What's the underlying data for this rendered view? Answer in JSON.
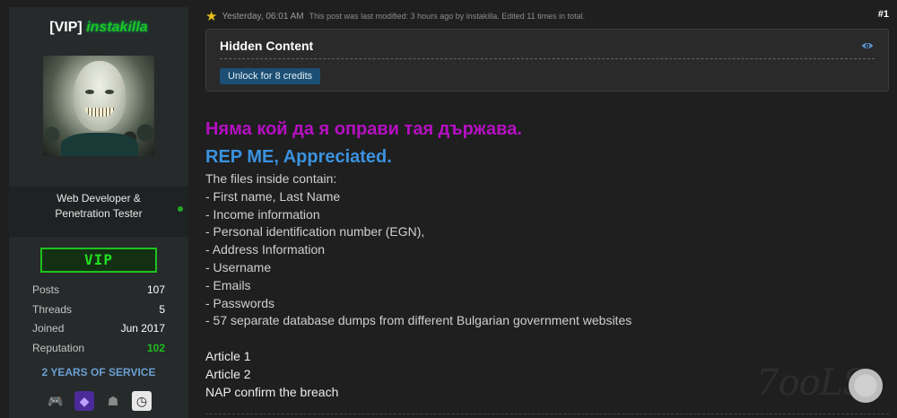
{
  "user": {
    "vip_tag": "[VIP]",
    "name": "instakilla",
    "title_line1": "Web Developer &",
    "title_line2": "Penetration Tester",
    "badge": "VIP",
    "stats": [
      {
        "label": "Posts",
        "value": "107"
      },
      {
        "label": "Threads",
        "value": "5"
      },
      {
        "label": "Joined",
        "value": "Jun 2017"
      },
      {
        "label": "Reputation",
        "value": "102"
      }
    ],
    "service": "2 YEARS OF SERVICE",
    "awards": [
      "controller-icon",
      "purple-badge-icon",
      "helmet-icon",
      "clock-icon"
    ]
  },
  "post": {
    "date": "Yesterday, 06:01 AM",
    "modified": "This post was last modified: 3 hours ago by instakilla. Edited 11 times in total.",
    "number": "#1",
    "hidden_title": "Hidden Content",
    "unlock_label": "Unlock for 8 credits",
    "headline_bg": "Няма кой да я оправи тая държава.",
    "headline_rep": "REP ME, Appreciated.",
    "lines": [
      "The files inside contain:",
      "- First name, Last Name",
      "- Income information",
      "- Personal identification number (EGN),",
      "- Address Information",
      "- Username",
      "- Emails",
      "- Passwords",
      "- 57 separate database dumps from different Bulgarian government websites"
    ],
    "links": [
      "Article 1",
      "Article 2",
      "NAP confirm the breach"
    ]
  },
  "watermark": "7ooLS",
  "colors": {
    "background": "#1f1f1f",
    "sidebar": "#262a2b",
    "username_green": "#1ec51e",
    "headline_purple": "#b50fc2",
    "headline_blue": "#3a92e0",
    "unlock_button": "#1b4f73",
    "service_blue": "#6a9fd1"
  }
}
